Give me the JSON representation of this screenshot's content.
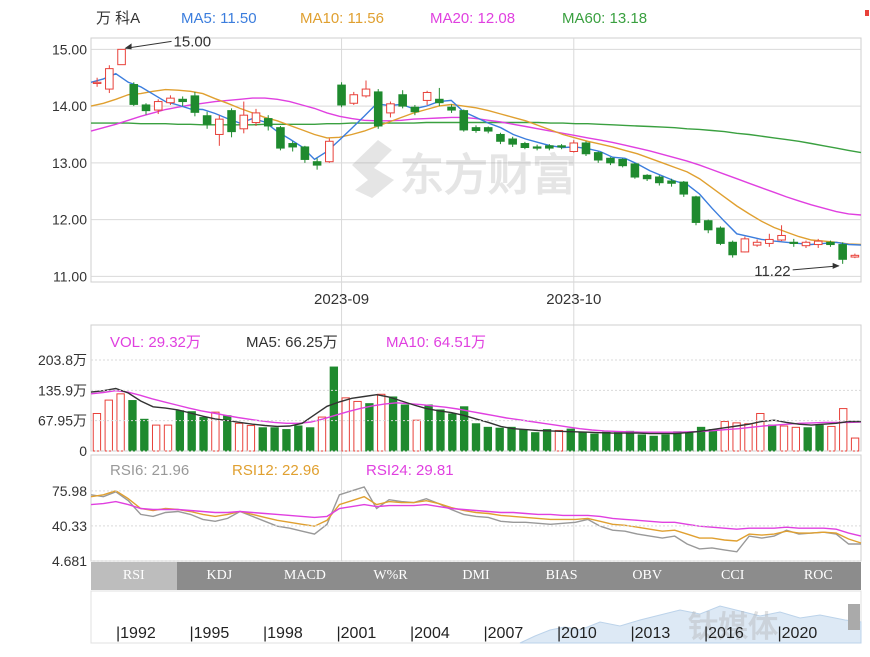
{
  "stock_name": "万 科A",
  "header": {
    "ma5_label": "MA5: 11.50",
    "ma10_label": "MA10: 11.56",
    "ma20_label": "MA20: 12.08",
    "ma60_label": "MA60: 13.18"
  },
  "colors": {
    "up": "#e8413a",
    "down": "#1f8a2e",
    "ma5": "#3b7ddd",
    "ma10": "#e0a030",
    "ma20": "#e040e0",
    "ma60": "#3aa040",
    "grid": "#d9d9d9",
    "rsi6": "#999999"
  },
  "price_axis": {
    "ticks": [
      "15.00",
      "14.00",
      "13.00",
      "12.00",
      "11.00"
    ],
    "ylim": [
      10.9,
      15.2
    ]
  },
  "annotations": {
    "high": "15.00",
    "low": "11.22"
  },
  "date_labels": [
    "2023-09",
    "2023-10"
  ],
  "chart_data": [
    {
      "type": "candlestick",
      "categories_note": "",
      "candles": [
        [
          14.4,
          14.42,
          14.34,
          14.5
        ],
        [
          14.3,
          14.66,
          14.23,
          14.72
        ],
        [
          14.73,
          15.0,
          14.73,
          15.0
        ],
        [
          14.38,
          14.03,
          14.0,
          14.42
        ],
        [
          14.02,
          13.92,
          13.85,
          14.05
        ],
        [
          13.93,
          14.08,
          13.86,
          14.12
        ],
        [
          14.06,
          14.14,
          14.02,
          14.19
        ],
        [
          14.12,
          14.08,
          14.0,
          14.17
        ],
        [
          14.18,
          13.89,
          13.82,
          14.25
        ],
        [
          13.83,
          13.68,
          13.6,
          13.9
        ],
        [
          13.5,
          13.77,
          13.3,
          13.84
        ],
        [
          13.92,
          13.55,
          13.45,
          13.96
        ],
        [
          13.6,
          13.84,
          13.52,
          14.08
        ],
        [
          13.71,
          13.88,
          13.65,
          13.95
        ],
        [
          13.78,
          13.65,
          13.57,
          13.84
        ],
        [
          13.62,
          13.26,
          13.22,
          13.65
        ],
        [
          13.34,
          13.28,
          13.2,
          13.38
        ],
        [
          13.28,
          13.06,
          13.0,
          13.3
        ],
        [
          13.02,
          12.96,
          12.88,
          13.08
        ],
        [
          13.02,
          13.38,
          13.0,
          13.43
        ],
        [
          14.37,
          14.02,
          13.98,
          14.42
        ],
        [
          14.05,
          14.2,
          14.02,
          14.25
        ],
        [
          14.18,
          14.3,
          14.15,
          14.45
        ],
        [
          14.25,
          13.65,
          13.6,
          14.3
        ],
        [
          13.88,
          14.04,
          13.8,
          14.08
        ],
        [
          14.2,
          14.0,
          13.96,
          14.28
        ],
        [
          13.98,
          13.9,
          13.84,
          14.02
        ],
        [
          14.1,
          14.24,
          14.02,
          14.27
        ],
        [
          14.12,
          14.06,
          14.0,
          14.32
        ],
        [
          13.98,
          13.93,
          13.88,
          14.03
        ],
        [
          13.92,
          13.58,
          13.55,
          13.94
        ],
        [
          13.62,
          13.57,
          13.53,
          13.66
        ],
        [
          13.62,
          13.56,
          13.52,
          13.64
        ],
        [
          13.5,
          13.38,
          13.33,
          13.53
        ],
        [
          13.42,
          13.33,
          13.28,
          13.46
        ],
        [
          13.34,
          13.27,
          13.24,
          13.37
        ],
        [
          13.28,
          13.26,
          13.22,
          13.32
        ],
        [
          13.3,
          13.26,
          13.22,
          13.33
        ],
        [
          13.3,
          13.28,
          13.24,
          13.33
        ],
        [
          13.2,
          13.35,
          13.18,
          13.4
        ],
        [
          13.35,
          13.16,
          13.12,
          13.38
        ],
        [
          13.18,
          13.05,
          13.0,
          13.2
        ],
        [
          13.08,
          13.0,
          12.96,
          13.1
        ],
        [
          13.06,
          12.95,
          12.92,
          13.08
        ],
        [
          12.98,
          12.75,
          12.72,
          13.0
        ],
        [
          12.78,
          12.72,
          12.68,
          12.8
        ],
        [
          12.75,
          12.65,
          12.6,
          12.78
        ],
        [
          12.68,
          12.64,
          12.58,
          12.72
        ],
        [
          12.66,
          12.45,
          12.4,
          12.68
        ],
        [
          12.4,
          11.95,
          11.9,
          12.42
        ],
        [
          11.98,
          11.82,
          11.76,
          12.0
        ],
        [
          11.85,
          11.58,
          11.55,
          11.88
        ],
        [
          11.6,
          11.38,
          11.33,
          11.63
        ],
        [
          11.43,
          11.66,
          11.42,
          11.7
        ],
        [
          11.55,
          11.6,
          11.52,
          11.65
        ],
        [
          11.58,
          11.65,
          11.52,
          11.75
        ],
        [
          11.64,
          11.72,
          11.62,
          11.9
        ],
        [
          11.6,
          11.58,
          11.52,
          11.66
        ],
        [
          11.54,
          11.6,
          11.5,
          11.63
        ],
        [
          11.56,
          11.62,
          11.5,
          11.66
        ],
        [
          11.6,
          11.56,
          11.52,
          11.63
        ],
        [
          11.56,
          11.3,
          11.22,
          11.6
        ],
        [
          11.34,
          11.37,
          11.32,
          11.4
        ]
      ],
      "ma5": [
        14.42,
        14.48,
        14.57,
        14.42,
        14.34,
        14.21,
        14.08,
        14.02,
        13.95,
        13.94,
        13.87,
        13.78,
        13.7,
        13.78,
        13.72,
        13.55,
        13.42,
        13.28,
        13.06,
        13.2,
        13.4,
        13.61,
        13.82,
        14.04,
        14.01,
        14.03,
        13.95,
        14.0,
        14.08,
        14.1,
        13.9,
        13.8,
        13.7,
        13.62,
        13.5,
        13.42,
        13.36,
        13.3,
        13.27,
        13.28,
        13.25,
        13.2,
        13.1,
        13.08,
        12.98,
        12.86,
        12.77,
        12.68,
        12.62,
        12.45,
        12.2,
        11.97,
        11.75,
        11.7,
        11.65,
        11.62,
        11.6,
        11.58,
        11.56,
        11.58,
        11.6,
        11.56,
        11.55
      ],
      "ma10": [
        14.0,
        14.05,
        14.12,
        14.2,
        14.22,
        14.26,
        14.29,
        14.28,
        14.26,
        14.22,
        14.13,
        14.05,
        13.96,
        13.88,
        13.8,
        13.74,
        13.66,
        13.58,
        13.5,
        13.44,
        13.45,
        13.5,
        13.56,
        13.64,
        13.72,
        13.8,
        13.88,
        13.94,
        14.0,
        14.03,
        14.0,
        13.97,
        13.92,
        13.86,
        13.8,
        13.74,
        13.66,
        13.58,
        13.5,
        13.44,
        13.38,
        13.33,
        13.28,
        13.22,
        13.16,
        13.08,
        13.0,
        12.92,
        12.84,
        12.72,
        12.56,
        12.4,
        12.24,
        12.1,
        11.97,
        11.86,
        11.78,
        11.7,
        11.64,
        11.62,
        11.6,
        11.57,
        11.56
      ],
      "ma20": [
        13.56,
        13.62,
        13.68,
        13.75,
        13.82,
        13.88,
        13.94,
        13.98,
        14.02,
        14.05,
        14.08,
        14.1,
        14.12,
        14.14,
        14.14,
        14.12,
        14.08,
        14.02,
        13.96,
        13.88,
        13.82,
        13.78,
        13.75,
        13.74,
        13.74,
        13.75,
        13.77,
        13.78,
        13.79,
        13.8,
        13.8,
        13.78,
        13.75,
        13.72,
        13.68,
        13.64,
        13.6,
        13.56,
        13.52,
        13.48,
        13.44,
        13.4,
        13.36,
        13.31,
        13.26,
        13.21,
        13.15,
        13.09,
        13.03,
        12.96,
        12.88,
        12.8,
        12.72,
        12.64,
        12.56,
        12.48,
        12.4,
        12.33,
        12.26,
        12.2,
        12.14,
        12.1,
        12.08
      ],
      "ma60": [
        13.7,
        13.7,
        13.7,
        13.7,
        13.69,
        13.69,
        13.69,
        13.68,
        13.68,
        13.67,
        13.67,
        13.67,
        13.67,
        13.67,
        13.68,
        13.68,
        13.68,
        13.68,
        13.68,
        13.69,
        13.69,
        13.7,
        13.7,
        13.7,
        13.7,
        13.7,
        13.7,
        13.71,
        13.71,
        13.71,
        13.71,
        13.71,
        13.71,
        13.71,
        13.71,
        13.71,
        13.71,
        13.7,
        13.7,
        13.69,
        13.69,
        13.68,
        13.67,
        13.66,
        13.65,
        13.64,
        13.63,
        13.62,
        13.6,
        13.59,
        13.57,
        13.55,
        13.52,
        13.5,
        13.47,
        13.44,
        13.41,
        13.38,
        13.34,
        13.3,
        13.26,
        13.22,
        13.18
      ]
    },
    {
      "type": "bar",
      "title_vol": "VOL: 29.32万",
      "title_ma5": "MA5: 66.25万",
      "title_ma10": "MA10: 64.51万",
      "yticks": [
        "203.8万",
        "135.9万",
        "67.95万",
        "0"
      ],
      "ylim": [
        0,
        203.8
      ],
      "values": [
        84,
        114,
        128,
        113,
        71,
        58,
        58,
        90,
        88,
        75,
        87,
        79,
        62,
        57,
        52,
        52,
        48,
        56,
        52,
        76,
        188,
        119,
        111,
        106,
        127,
        121,
        103,
        69,
        103,
        92,
        83,
        99,
        61,
        53,
        51,
        53,
        47,
        41,
        48,
        46,
        49,
        42,
        38,
        42,
        41,
        44,
        36,
        33,
        36,
        43,
        40,
        53,
        48,
        66,
        63,
        61,
        84,
        58,
        56,
        53,
        52,
        57,
        55,
        95,
        29
      ],
      "ma5": [
        132,
        135,
        140,
        130,
        112,
        99,
        96,
        92,
        85,
        78,
        72,
        68,
        64,
        60,
        57,
        55,
        56,
        62,
        81,
        100,
        110,
        118,
        122,
        126,
        121,
        112,
        103,
        95,
        90,
        86,
        80,
        72,
        64,
        55,
        50,
        48,
        46,
        45,
        44,
        43,
        42,
        41,
        40,
        40,
        40,
        39,
        39,
        39,
        41,
        44,
        48,
        52,
        56,
        60,
        66,
        69,
        64,
        60,
        58,
        60,
        62,
        66,
        66
      ],
      "ma10": [
        128,
        131,
        135,
        132,
        125,
        117,
        110,
        103,
        96,
        90,
        85,
        80,
        75,
        71,
        67,
        64,
        62,
        62,
        65,
        72,
        80,
        88,
        95,
        101,
        105,
        108,
        106,
        104,
        101,
        98,
        94,
        89,
        84,
        79,
        74,
        70,
        66,
        62,
        58,
        54,
        50,
        47,
        45,
        44,
        43,
        42,
        42,
        42,
        42,
        43,
        44,
        46,
        48,
        50,
        53,
        56,
        58,
        60,
        62,
        63,
        64,
        64,
        64,
        65
      ]
    },
    {
      "type": "line",
      "title_rsi6": "RSI6: 21.96",
      "title_rsi12": "RSI12: 22.96",
      "title_rsi24": "RSI24: 29.81",
      "yticks": [
        "75.98",
        "40.33",
        "4.681"
      ],
      "ylim": [
        4.681,
        87
      ],
      "series": [
        {
          "name": "RSI6",
          "values": [
            72,
            70,
            75,
            66,
            52,
            50,
            54,
            55,
            52,
            47,
            45,
            48,
            55,
            50,
            45,
            40,
            38,
            35,
            32,
            42,
            72,
            76,
            80,
            58,
            67,
            65,
            64,
            68,
            63,
            57,
            52,
            50,
            49,
            45,
            44,
            44,
            43,
            42,
            43,
            44,
            47,
            40,
            36,
            35,
            32,
            30,
            28,
            30,
            22,
            17,
            18,
            16,
            14,
            30,
            28,
            30,
            36,
            32,
            33,
            34,
            32,
            22,
            22
          ]
        },
        {
          "name": "RSI12",
          "values": [
            70,
            72,
            76,
            68,
            58,
            56,
            58,
            57,
            55,
            52,
            50,
            52,
            55,
            52,
            49,
            46,
            44,
            42,
            40,
            46,
            62,
            66,
            70,
            62,
            65,
            64,
            64,
            66,
            63,
            59,
            56,
            54,
            53,
            51,
            50,
            49,
            48,
            47,
            47,
            47,
            48,
            45,
            42,
            41,
            39,
            37,
            35,
            36,
            32,
            28,
            28,
            26,
            25,
            32,
            31,
            32,
            35,
            33,
            33,
            34,
            33,
            27,
            23
          ]
        },
        {
          "name": "RSI24",
          "values": [
            62,
            63,
            65,
            62,
            58,
            57,
            57,
            57,
            56,
            55,
            54,
            54,
            55,
            54,
            53,
            52,
            51,
            50,
            49,
            50,
            58,
            60,
            62,
            60,
            61,
            61,
            61,
            62,
            60,
            58,
            57,
            56,
            55,
            54,
            54,
            53,
            52,
            52,
            51,
            51,
            51,
            50,
            48,
            47,
            46,
            45,
            44,
            44,
            42,
            40,
            39,
            38,
            37,
            38,
            38,
            38,
            39,
            38,
            38,
            38,
            37,
            33,
            30
          ]
        }
      ]
    },
    {
      "type": "area",
      "xticks": [
        "|1992",
        "|1995",
        "|1998",
        "|2001",
        "|2004",
        "|2007",
        "|2010",
        "|2013",
        "|2016",
        "|2020"
      ]
    }
  ],
  "tabs": [
    "RSI",
    "KDJ",
    "MACD",
    "W%R",
    "DMI",
    "BIAS",
    "OBV",
    "CCI",
    "ROC"
  ],
  "active_tab": "RSI",
  "watermark_icon": "eastmoney-logo-icon"
}
